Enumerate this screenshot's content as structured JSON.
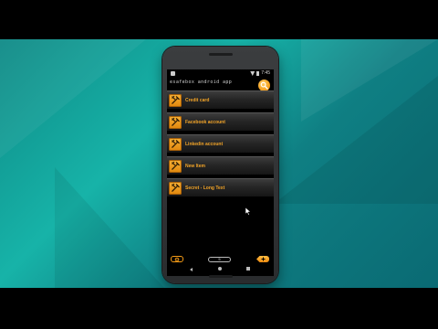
{
  "app": {
    "title": "esafebox android app",
    "status_time": "7:45"
  },
  "toolbar": {
    "search_icon": "search-icon"
  },
  "items": [
    {
      "label": "Credit card",
      "icon": "tools-icon"
    },
    {
      "label": "Facebook account",
      "icon": "tools-icon"
    },
    {
      "label": "Linkedin account",
      "icon": "tools-icon"
    },
    {
      "label": "New Item",
      "icon": "tools-icon"
    },
    {
      "label": "Secret - Long Text",
      "icon": "tools-icon"
    }
  ],
  "footer": {
    "text": "",
    "page_indicator": "5"
  },
  "colors": {
    "accent": "#f39a16",
    "item_text": "#f2a428",
    "background_teal": "#17b3a8"
  }
}
